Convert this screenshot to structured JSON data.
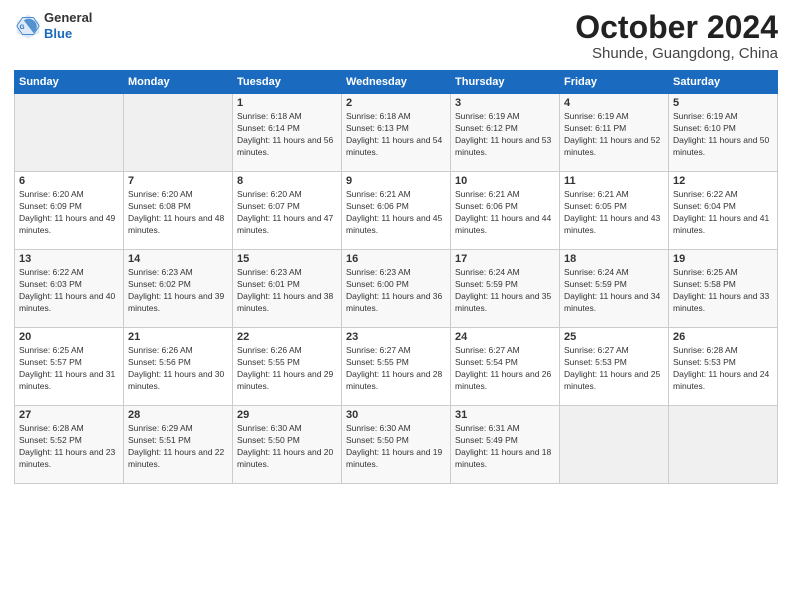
{
  "logo": {
    "general": "General",
    "blue": "Blue"
  },
  "header": {
    "month": "October 2024",
    "location": "Shunde, Guangdong, China"
  },
  "days_of_week": [
    "Sunday",
    "Monday",
    "Tuesday",
    "Wednesday",
    "Thursday",
    "Friday",
    "Saturday"
  ],
  "weeks": [
    [
      {
        "day": "",
        "sunrise": "",
        "sunset": "",
        "daylight": ""
      },
      {
        "day": "",
        "sunrise": "",
        "sunset": "",
        "daylight": ""
      },
      {
        "day": "1",
        "sunrise": "Sunrise: 6:18 AM",
        "sunset": "Sunset: 6:14 PM",
        "daylight": "Daylight: 11 hours and 56 minutes."
      },
      {
        "day": "2",
        "sunrise": "Sunrise: 6:18 AM",
        "sunset": "Sunset: 6:13 PM",
        "daylight": "Daylight: 11 hours and 54 minutes."
      },
      {
        "day": "3",
        "sunrise": "Sunrise: 6:19 AM",
        "sunset": "Sunset: 6:12 PM",
        "daylight": "Daylight: 11 hours and 53 minutes."
      },
      {
        "day": "4",
        "sunrise": "Sunrise: 6:19 AM",
        "sunset": "Sunset: 6:11 PM",
        "daylight": "Daylight: 11 hours and 52 minutes."
      },
      {
        "day": "5",
        "sunrise": "Sunrise: 6:19 AM",
        "sunset": "Sunset: 6:10 PM",
        "daylight": "Daylight: 11 hours and 50 minutes."
      }
    ],
    [
      {
        "day": "6",
        "sunrise": "Sunrise: 6:20 AM",
        "sunset": "Sunset: 6:09 PM",
        "daylight": "Daylight: 11 hours and 49 minutes."
      },
      {
        "day": "7",
        "sunrise": "Sunrise: 6:20 AM",
        "sunset": "Sunset: 6:08 PM",
        "daylight": "Daylight: 11 hours and 48 minutes."
      },
      {
        "day": "8",
        "sunrise": "Sunrise: 6:20 AM",
        "sunset": "Sunset: 6:07 PM",
        "daylight": "Daylight: 11 hours and 47 minutes."
      },
      {
        "day": "9",
        "sunrise": "Sunrise: 6:21 AM",
        "sunset": "Sunset: 6:06 PM",
        "daylight": "Daylight: 11 hours and 45 minutes."
      },
      {
        "day": "10",
        "sunrise": "Sunrise: 6:21 AM",
        "sunset": "Sunset: 6:06 PM",
        "daylight": "Daylight: 11 hours and 44 minutes."
      },
      {
        "day": "11",
        "sunrise": "Sunrise: 6:21 AM",
        "sunset": "Sunset: 6:05 PM",
        "daylight": "Daylight: 11 hours and 43 minutes."
      },
      {
        "day": "12",
        "sunrise": "Sunrise: 6:22 AM",
        "sunset": "Sunset: 6:04 PM",
        "daylight": "Daylight: 11 hours and 41 minutes."
      }
    ],
    [
      {
        "day": "13",
        "sunrise": "Sunrise: 6:22 AM",
        "sunset": "Sunset: 6:03 PM",
        "daylight": "Daylight: 11 hours and 40 minutes."
      },
      {
        "day": "14",
        "sunrise": "Sunrise: 6:23 AM",
        "sunset": "Sunset: 6:02 PM",
        "daylight": "Daylight: 11 hours and 39 minutes."
      },
      {
        "day": "15",
        "sunrise": "Sunrise: 6:23 AM",
        "sunset": "Sunset: 6:01 PM",
        "daylight": "Daylight: 11 hours and 38 minutes."
      },
      {
        "day": "16",
        "sunrise": "Sunrise: 6:23 AM",
        "sunset": "Sunset: 6:00 PM",
        "daylight": "Daylight: 11 hours and 36 minutes."
      },
      {
        "day": "17",
        "sunrise": "Sunrise: 6:24 AM",
        "sunset": "Sunset: 5:59 PM",
        "daylight": "Daylight: 11 hours and 35 minutes."
      },
      {
        "day": "18",
        "sunrise": "Sunrise: 6:24 AM",
        "sunset": "Sunset: 5:59 PM",
        "daylight": "Daylight: 11 hours and 34 minutes."
      },
      {
        "day": "19",
        "sunrise": "Sunrise: 6:25 AM",
        "sunset": "Sunset: 5:58 PM",
        "daylight": "Daylight: 11 hours and 33 minutes."
      }
    ],
    [
      {
        "day": "20",
        "sunrise": "Sunrise: 6:25 AM",
        "sunset": "Sunset: 5:57 PM",
        "daylight": "Daylight: 11 hours and 31 minutes."
      },
      {
        "day": "21",
        "sunrise": "Sunrise: 6:26 AM",
        "sunset": "Sunset: 5:56 PM",
        "daylight": "Daylight: 11 hours and 30 minutes."
      },
      {
        "day": "22",
        "sunrise": "Sunrise: 6:26 AM",
        "sunset": "Sunset: 5:55 PM",
        "daylight": "Daylight: 11 hours and 29 minutes."
      },
      {
        "day": "23",
        "sunrise": "Sunrise: 6:27 AM",
        "sunset": "Sunset: 5:55 PM",
        "daylight": "Daylight: 11 hours and 28 minutes."
      },
      {
        "day": "24",
        "sunrise": "Sunrise: 6:27 AM",
        "sunset": "Sunset: 5:54 PM",
        "daylight": "Daylight: 11 hours and 26 minutes."
      },
      {
        "day": "25",
        "sunrise": "Sunrise: 6:27 AM",
        "sunset": "Sunset: 5:53 PM",
        "daylight": "Daylight: 11 hours and 25 minutes."
      },
      {
        "day": "26",
        "sunrise": "Sunrise: 6:28 AM",
        "sunset": "Sunset: 5:53 PM",
        "daylight": "Daylight: 11 hours and 24 minutes."
      }
    ],
    [
      {
        "day": "27",
        "sunrise": "Sunrise: 6:28 AM",
        "sunset": "Sunset: 5:52 PM",
        "daylight": "Daylight: 11 hours and 23 minutes."
      },
      {
        "day": "28",
        "sunrise": "Sunrise: 6:29 AM",
        "sunset": "Sunset: 5:51 PM",
        "daylight": "Daylight: 11 hours and 22 minutes."
      },
      {
        "day": "29",
        "sunrise": "Sunrise: 6:30 AM",
        "sunset": "Sunset: 5:50 PM",
        "daylight": "Daylight: 11 hours and 20 minutes."
      },
      {
        "day": "30",
        "sunrise": "Sunrise: 6:30 AM",
        "sunset": "Sunset: 5:50 PM",
        "daylight": "Daylight: 11 hours and 19 minutes."
      },
      {
        "day": "31",
        "sunrise": "Sunrise: 6:31 AM",
        "sunset": "Sunset: 5:49 PM",
        "daylight": "Daylight: 11 hours and 18 minutes."
      },
      {
        "day": "",
        "sunrise": "",
        "sunset": "",
        "daylight": ""
      },
      {
        "day": "",
        "sunrise": "",
        "sunset": "",
        "daylight": ""
      }
    ]
  ]
}
